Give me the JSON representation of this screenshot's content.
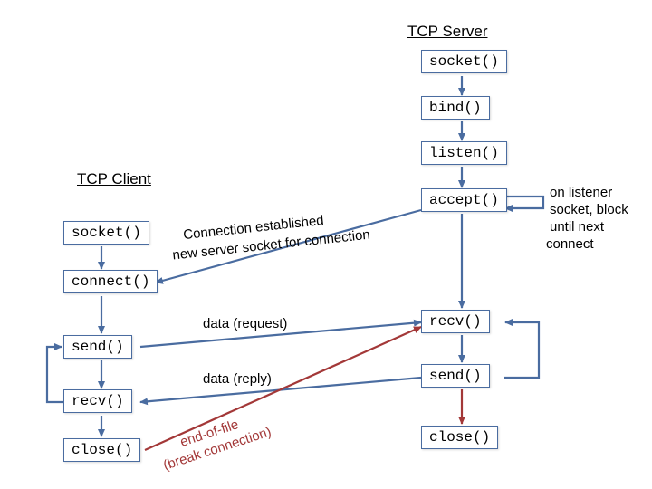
{
  "titles": {
    "client": "TCP Client",
    "server": "TCP Server"
  },
  "client": {
    "socket": "socket()",
    "connect": "connect()",
    "send": "send()",
    "recv": "recv()",
    "close": "close()"
  },
  "server": {
    "socket": "socket()",
    "bind": "bind()",
    "listen": "listen()",
    "accept": "accept()",
    "recv": "recv()",
    "send": "send()",
    "close": "close()"
  },
  "labels": {
    "conn1": "Connection established",
    "conn2": "new server socket for connection",
    "req": "data (request)",
    "rep": "data (reply)",
    "eof1": "end-of-file",
    "eof2": "(break connection)",
    "listener1": "on listener",
    "listener2": "socket, block",
    "listener3": "until next",
    "listener4": " connect"
  }
}
